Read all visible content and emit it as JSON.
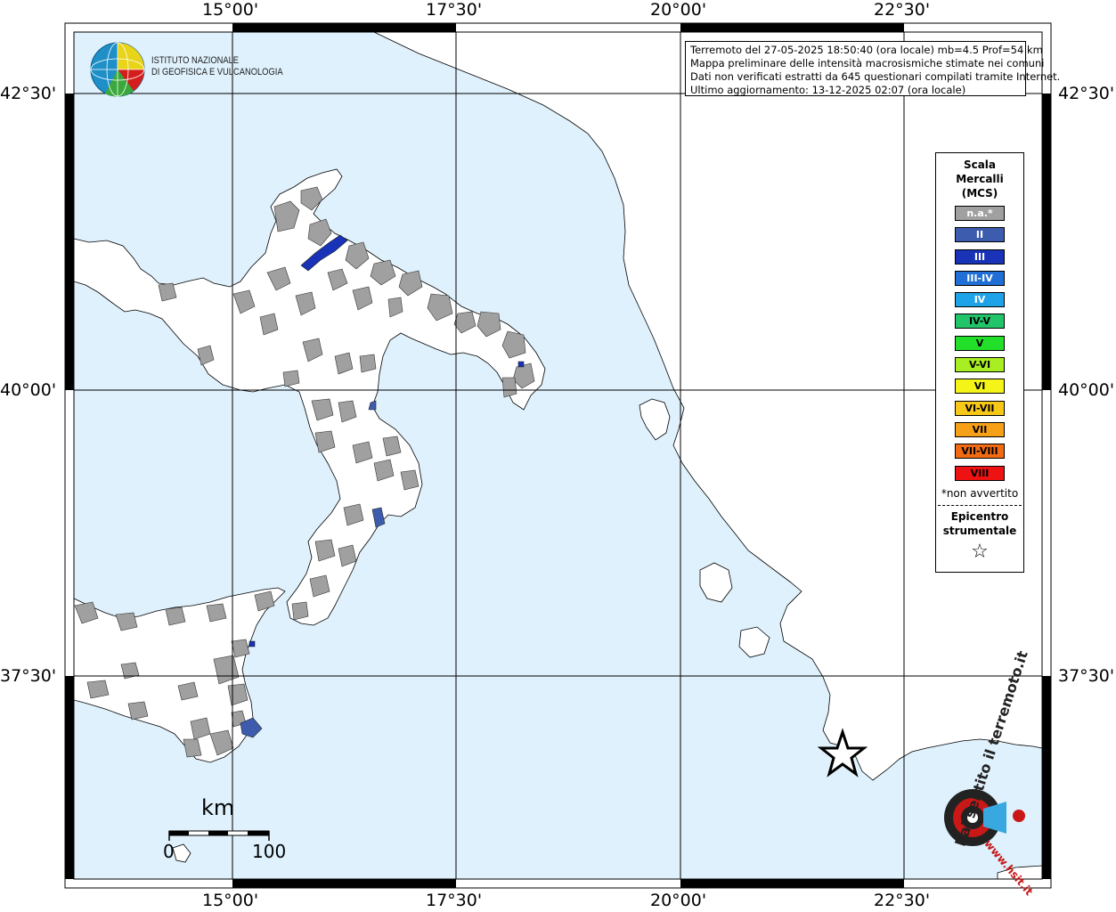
{
  "info": {
    "line1": "Terremoto del 27-05-2025 18:50:40 (ora locale) mb=4.5 Prof=54 km",
    "line2": "Mappa preliminare delle intensità macrosismiche stimate nei comuni",
    "line3": "Dati non verificati estratti da 645 questionari compilati tramite Internet.",
    "line4": "Ultimo aggiornamento: 13-12-2025 02:07 (ora locale)"
  },
  "logo": {
    "line1": "ISTITUTO NAZIONALE",
    "line2": "DI GEOFISICA E VULCANOLOGIA"
  },
  "coords": {
    "lon": [
      "15°00'",
      "17°30'",
      "20°00'",
      "22°30'"
    ],
    "lat": [
      "42°30'",
      "40°00'",
      "37°30'"
    ]
  },
  "legend": {
    "title1": "Scala",
    "title2": "Mercalli",
    "title3": "(MCS)",
    "items": [
      {
        "label": "n.a.*",
        "color": "#a0a0a0",
        "text": "#ffffff"
      },
      {
        "label": "II",
        "color": "#3d5cae",
        "text": "#ffffff"
      },
      {
        "label": "III",
        "color": "#1832b8",
        "text": "#ffffff"
      },
      {
        "label": "III-IV",
        "color": "#1f6fd6",
        "text": "#ffffff"
      },
      {
        "label": "IV",
        "color": "#1fa3e8",
        "text": "#ffffff"
      },
      {
        "label": "IV-V",
        "color": "#22c46a",
        "text": "#000000"
      },
      {
        "label": "V",
        "color": "#22e02a",
        "text": "#000000"
      },
      {
        "label": "V-VI",
        "color": "#a8ee22",
        "text": "#000000"
      },
      {
        "label": "VI",
        "color": "#f4f418",
        "text": "#000000"
      },
      {
        "label": "VI-VII",
        "color": "#f8c818",
        "text": "#000000"
      },
      {
        "label": "VII",
        "color": "#f6a018",
        "text": "#000000"
      },
      {
        "label": "VII-VIII",
        "color": "#f26a12",
        "text": "#000000"
      },
      {
        "label": "VIII",
        "color": "#ee1212",
        "text": "#000000"
      }
    ],
    "note": "*non avvertito",
    "epi1": "Epicentro",
    "epi2": "strumentale",
    "star": "☆"
  },
  "scale": {
    "unit": "km",
    "min": "0",
    "max": "100"
  },
  "watermark": {
    "text": "hai sentito il terremoto.it",
    "url": "www.hsit.it"
  },
  "colors": {
    "sea": "#dff1fc",
    "land": "#ffffff",
    "na": "#a0a0a0",
    "ii": "#3d5cae",
    "iii": "#1832b8"
  }
}
